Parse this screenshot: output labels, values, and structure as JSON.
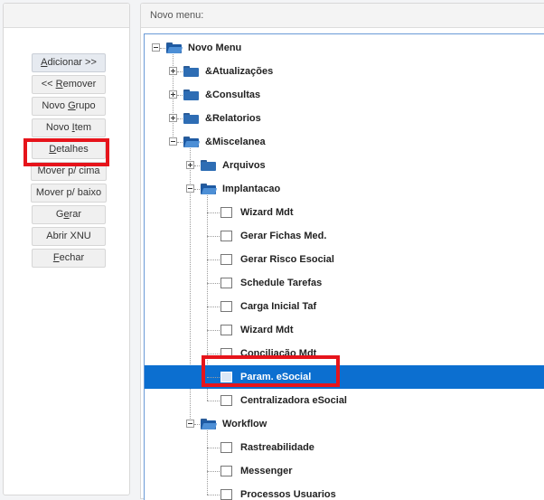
{
  "right_panel": {
    "header": "Novo menu:"
  },
  "buttons": [
    {
      "pre": "",
      "u": "A",
      "post": "dicionar >>"
    },
    {
      "pre": "<< ",
      "u": "R",
      "post": "emover"
    },
    {
      "pre": "Novo ",
      "u": "G",
      "post": "rupo"
    },
    {
      "pre": "Novo ",
      "u": "I",
      "post": "tem"
    },
    {
      "pre": "",
      "u": "D",
      "post": "etalhes"
    },
    {
      "pre": "Mover p/ cima",
      "u": "",
      "post": ""
    },
    {
      "pre": "Mover p/ baixo",
      "u": "",
      "post": ""
    },
    {
      "pre": "G",
      "u": "e",
      "post": "rar"
    },
    {
      "pre": "Abrir XNU",
      "u": "",
      "post": ""
    },
    {
      "pre": "",
      "u": "F",
      "post": "echar"
    }
  ],
  "tree": [
    {
      "label": "Novo Menu",
      "level": 0,
      "type": "folder",
      "expander": "minus",
      "icon": "folder-open-icon"
    },
    {
      "label": "&Atualizações",
      "level": 1,
      "type": "folder",
      "expander": "plus",
      "icon": "folder-icon"
    },
    {
      "label": "&Consultas",
      "level": 1,
      "type": "folder",
      "expander": "plus",
      "icon": "folder-icon"
    },
    {
      "label": "&Relatorios",
      "level": 1,
      "type": "folder",
      "expander": "plus",
      "icon": "folder-icon"
    },
    {
      "label": "&Miscelanea",
      "level": 1,
      "type": "folder",
      "expander": "minus",
      "icon": "folder-open-icon"
    },
    {
      "label": "Arquivos",
      "level": 2,
      "type": "folder",
      "expander": "plus",
      "icon": "folder-icon"
    },
    {
      "label": "Implantacao",
      "level": 2,
      "type": "folder",
      "expander": "minus",
      "icon": "folder-open-icon"
    },
    {
      "label": "Wizard Mdt",
      "level": 3,
      "type": "leaf",
      "icon": "document-icon"
    },
    {
      "label": "Gerar Fichas Med.",
      "level": 3,
      "type": "leaf",
      "icon": "document-icon"
    },
    {
      "label": "Gerar Risco Esocial",
      "level": 3,
      "type": "leaf",
      "icon": "document-icon"
    },
    {
      "label": "Schedule Tarefas",
      "level": 3,
      "type": "leaf",
      "icon": "document-icon"
    },
    {
      "label": "Carga Inicial Taf",
      "level": 3,
      "type": "leaf",
      "icon": "document-icon"
    },
    {
      "label": "Wizard Mdt",
      "level": 3,
      "type": "leaf",
      "icon": "document-icon"
    },
    {
      "label": "Conciliação Mdt",
      "level": 3,
      "type": "leaf",
      "icon": "document-icon"
    },
    {
      "label": "Param. eSocial",
      "level": 3,
      "type": "leaf",
      "selected": true,
      "icon": "document-icon"
    },
    {
      "label": "Centralizadora eSocial",
      "level": 3,
      "type": "leaf",
      "icon": "document-icon"
    },
    {
      "label": "Workflow",
      "level": 2,
      "type": "folder",
      "expander": "minus",
      "icon": "folder-open-icon"
    },
    {
      "label": "Rastreabilidade",
      "level": 3,
      "type": "leaf",
      "icon": "document-icon"
    },
    {
      "label": "Messenger",
      "level": 3,
      "type": "leaf",
      "icon": "document-icon"
    },
    {
      "label": "Processos Usuarios",
      "level": 3,
      "type": "leaf",
      "icon": "document-icon"
    }
  ],
  "colors": {
    "selection": "#0c6fd0",
    "highlight": "#e6141b",
    "folder": "#2e6db4"
  }
}
